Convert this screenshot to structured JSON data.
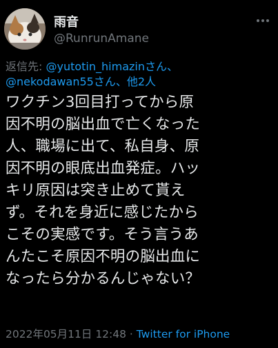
{
  "user": {
    "display_name": "雨音",
    "handle": "@RunrunAmane"
  },
  "reply_to": {
    "label": "返信先: ",
    "mention1": "@yutotin_himazin",
    "sep1": "さん、",
    "mention2": "@nekodawan55",
    "sep2": "さん、",
    "others": "他2人"
  },
  "tweet": {
    "lines": [
      "ワクチン3回目打ってから原",
      "因不明の脳出血で亡くなった",
      "人、職場に出て、私自身、原",
      "因不明の眼底出血発症。ハッ",
      "キリ原因は突き止めて貰え",
      "ず。それを身近に感じたから",
      "こその実感です。そう言うあ",
      "んたこそ原因不明の脳出血に",
      "なったら分かるんじゃない？"
    ]
  },
  "meta": {
    "timestamp": "2022年05月11日 12:48",
    "dot": " · ",
    "source": "Twitter for iPhone"
  },
  "icons": {
    "avatar": "cat-avatar",
    "more": "more-icon"
  },
  "colors": {
    "background": "#000000",
    "text": "#e7e9ea",
    "secondary": "#71767b",
    "link": "#1d9bf0"
  }
}
